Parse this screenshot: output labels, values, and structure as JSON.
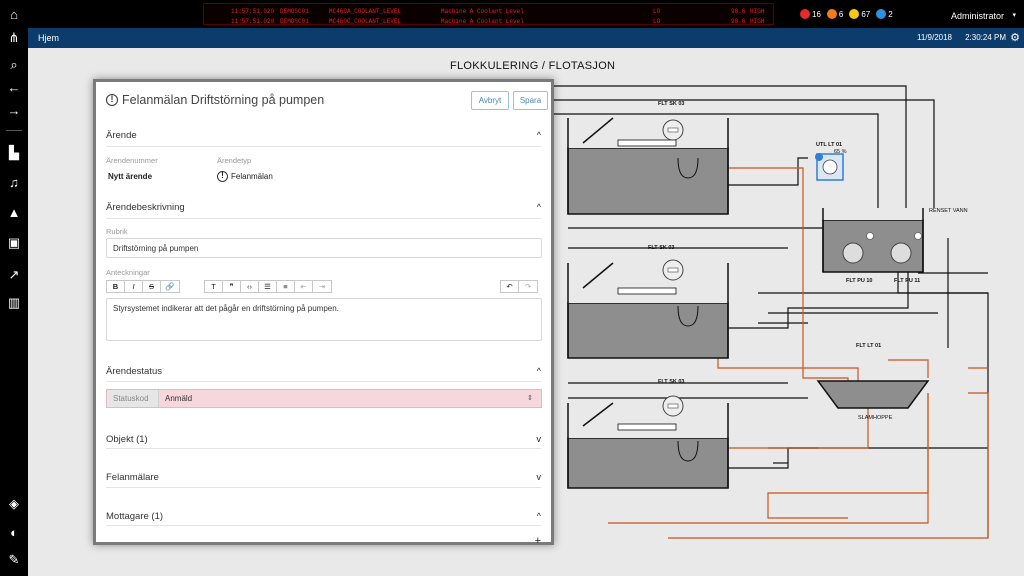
{
  "alarms": [
    {
      "time": "11:57:51.020",
      "source": "DEMOSC01",
      "tag": "MC460A_COOLANT_LEVEL",
      "desc": "Machine A Coolant Level",
      "state": "LO",
      "value": "98.6",
      "limit": "HIGH"
    },
    {
      "time": "11:57:51.020",
      "source": "DEMOSC01",
      "tag": "MC460C_COOLANT_LEVEL",
      "desc": "Machine A Coolant Level",
      "state": "LO",
      "value": "98.6",
      "limit": "HIGH"
    }
  ],
  "counters": [
    {
      "icon": "alarm-critical-icon",
      "count": "16",
      "color": "#e52b2b"
    },
    {
      "icon": "alarm-high-icon",
      "count": "6",
      "color": "#f07c1a"
    },
    {
      "icon": "alarm-medium-icon",
      "count": "67",
      "color": "#f5c518"
    },
    {
      "icon": "alarm-low-icon",
      "count": "2",
      "color": "#2f8fe0"
    }
  ],
  "user": "Administrator",
  "nav": {
    "crumb": "Hjem",
    "date": "11/9/2018",
    "time": "2:30:24 PM"
  },
  "diagram": {
    "title": "FLOKKULERING / FLOTASJON",
    "labels": {
      "sk1": "FLT SK 03",
      "sk2": "FLT SK 03",
      "sk3": "FLT SK 03",
      "utl": "UTL LT 01",
      "pct": "65 %",
      "renset": "RENSET VANN",
      "pu10": "FLT PU 10",
      "pu11": "FLT PU 11",
      "lt01": "FLT LT 01",
      "slam": "SLAMHOPPE"
    },
    "colors": {
      "pipe": "#111111",
      "sludge_pipe": "#c8561c",
      "water": "#909090",
      "accent": "#2f7fd8"
    }
  },
  "modal": {
    "title": "Felanmälan Driftstörning på pumpen",
    "cancel": "Avbryt",
    "save": "Spara",
    "section_arende": "Ärende",
    "lbl_number": "Ärendenummer",
    "val_number": "Nytt ärende",
    "lbl_type": "Ärendetyp",
    "val_type": "Felanmälan",
    "section_desc": "Ärendebeskrivning",
    "lbl_rubrik": "Rubrik",
    "rubrik": "Driftstörning på pumpen",
    "lbl_notes": "Anteckningar",
    "notes": "Styrsystemet indikerar att det pågår en driftstörning på pumpen.",
    "section_status": "Ärendestatus",
    "lbl_status": "Statuskod",
    "status": "Anmäld",
    "section_objekt": "Objekt  (1)",
    "section_felanm": "Felanmälare",
    "section_mott": "Mottagare  (1)",
    "toolbar": [
      "B",
      "I",
      "S",
      "🔗",
      "T",
      "❞",
      "‹›",
      "☰",
      "≡",
      "⇤",
      "⇥",
      "↶",
      "↷"
    ]
  }
}
